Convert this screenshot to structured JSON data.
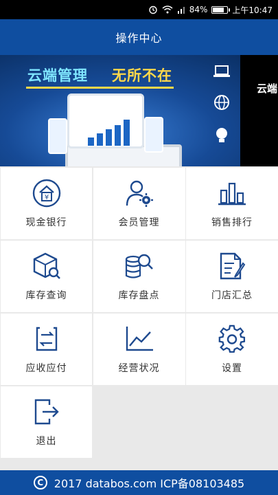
{
  "status_bar": {
    "battery": "84%",
    "battery_level": 0.84,
    "time": "上午10:47",
    "icons": [
      "alarm-icon",
      "wifi-icon",
      "signal-icon",
      "battery-icon"
    ]
  },
  "header": {
    "title": "操作中心"
  },
  "banner": {
    "slogan_part1": "云端管理",
    "slogan_part2": "无所不在",
    "next_slide_text": "云端",
    "active_slide": 2,
    "slide_count": 2
  },
  "menu": {
    "items": [
      {
        "label": "现金银行",
        "icon": "cash-bank-icon"
      },
      {
        "label": "会员管理",
        "icon": "member-management-icon"
      },
      {
        "label": "销售排行",
        "icon": "sales-ranking-icon"
      },
      {
        "label": "库存查询",
        "icon": "inventory-query-icon"
      },
      {
        "label": "库存盘点",
        "icon": "inventory-count-icon"
      },
      {
        "label": "门店汇总",
        "icon": "store-summary-icon"
      },
      {
        "label": "应收应付",
        "icon": "receivable-payable-icon"
      },
      {
        "label": "经营状况",
        "icon": "business-status-icon"
      },
      {
        "label": "设置",
        "icon": "settings-icon"
      },
      {
        "label": "退出",
        "icon": "logout-icon"
      }
    ]
  },
  "footer": {
    "text": "2017  databos.com  ICP备08103485"
  },
  "colors": {
    "brand_blue": "#0f4ea0",
    "icon_blue": "#1e4a8f",
    "active_dot": "#f0a417"
  }
}
